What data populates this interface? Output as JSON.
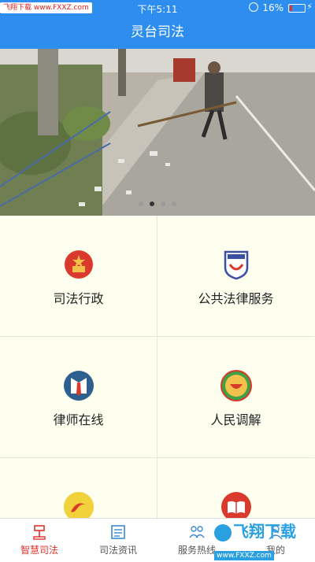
{
  "status_bar": {
    "carrier": "飞翔下载 www.FXXZ.com",
    "time": "下午5:11",
    "battery_percent": "16%",
    "battery_level": 0.16
  },
  "nav": {
    "title": "灵台司法"
  },
  "banner": {
    "slide_count": 4,
    "active_index": 1
  },
  "grid": {
    "items": [
      {
        "label": "司法行政",
        "icon": "emblem-icon"
      },
      {
        "label": "公共法律服务",
        "icon": "legal-service-badge-icon"
      },
      {
        "label": "律师在线",
        "icon": "lawyer-tie-icon"
      },
      {
        "label": "人民调解",
        "icon": "mediation-icon"
      },
      {
        "label": "",
        "icon": "community-icon"
      },
      {
        "label": "",
        "icon": "book-icon"
      }
    ]
  },
  "tabs": [
    {
      "label": "智慧司法",
      "icon": "gavel-icon",
      "active": true
    },
    {
      "label": "司法资讯",
      "icon": "news-icon",
      "active": false
    },
    {
      "label": "服务热线",
      "icon": "people-icon",
      "active": false
    },
    {
      "label": "我的",
      "icon": "user-icon",
      "active": false
    }
  ],
  "watermark": {
    "main": "飞翔下载",
    "sub": "www.FXXZ.com"
  },
  "colors": {
    "primary": "#2d8ef0",
    "active_tab": "#e0302a",
    "grid_bg": "#fffff0"
  }
}
